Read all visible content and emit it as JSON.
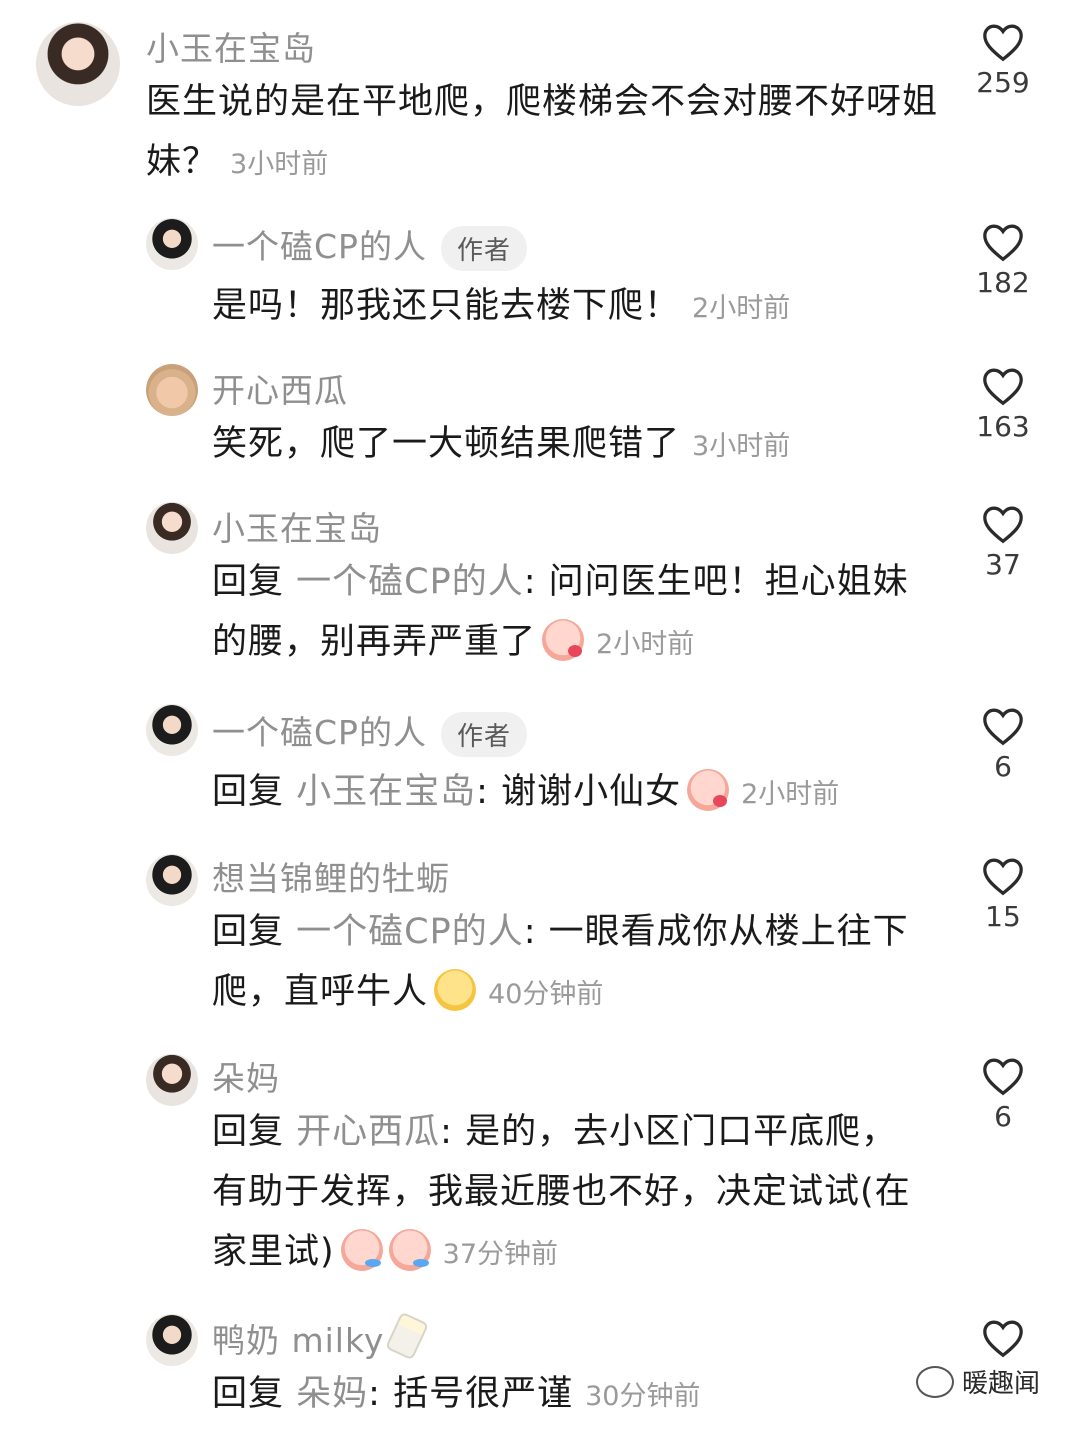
{
  "comments": [
    {
      "name": "小玉在宝岛",
      "text": "医生说的是在平地爬，爬楼梯会不会对腰不好呀姐妹？",
      "time": "3小时前",
      "likes": "259"
    },
    {
      "name": "一个磕CP的人",
      "badge": "作者",
      "text": "是吗！那我还只能去楼下爬！",
      "time": "2小时前",
      "likes": "182"
    },
    {
      "name": "开心西瓜",
      "text": "笑死，爬了一大顿结果爬错了",
      "time": "3小时前",
      "likes": "163"
    },
    {
      "name": "小玉在宝岛",
      "prefix": "回复",
      "target": "一个磕CP的人",
      "text": ": 问问医生吧！担心姐妹的腰，别再弄严重了",
      "time": "2小时前",
      "likes": "37"
    },
    {
      "name": "一个磕CP的人",
      "badge": "作者",
      "prefix": "回复",
      "target": "小玉在宝岛",
      "text": ": 谢谢小仙女",
      "time": "2小时前",
      "likes": "6"
    },
    {
      "name": "想当锦鲤的牡蛎",
      "prefix": "回复",
      "target": "一个磕CP的人",
      "text": ": 一眼看成你从楼上往下爬，直呼牛人",
      "time": "40分钟前",
      "likes": "15"
    },
    {
      "name": "朵妈",
      "prefix": "回复",
      "target": "开心西瓜",
      "text": ": 是的，去小区门口平底爬，有助于发挥，我最近腰也不好，决定试试(在家里试)",
      "time": "37分钟前",
      "likes": "6"
    },
    {
      "name": "鸭奶 milky",
      "prefix": "回复",
      "target": "朵妈",
      "text": ": 括号很严谨",
      "time": "30分钟前",
      "likes": ""
    }
  ],
  "watermark": "暖趣闻",
  "colors": {
    "name": "#8f8f8f",
    "text": "#1a1a1a",
    "time": "#9a9a9a"
  }
}
